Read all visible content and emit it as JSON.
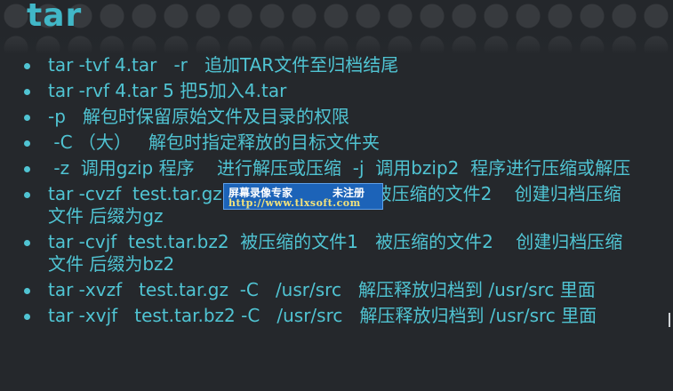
{
  "slide": {
    "title": "tar",
    "bullets": [
      {
        "text": "tar -tvf 4.tar   -r   追加TAR文件至归档结尾"
      },
      {
        "text": "tar -rvf 4.tar 5 把5加入4.tar"
      },
      {
        "text": "-p   解包时保留原始文件及目录的权限"
      },
      {
        "text": " -C （大）   解包时指定释放的目标文件夹"
      },
      {
        "text": " -z  调用gzip 程序    进行解压或压缩  -j  调用bzip2  程序进行压缩或解压"
      },
      {
        "text": "tar -cvzf  test.tar.gz   被压缩的文件1   被压缩的文件2    创建归档压缩文件 后缀为gz"
      },
      {
        "text": "tar -cvjf  test.tar.bz2  被压缩的文件1   被压缩的文件2    创建归档压缩文件 后缀为bz2"
      },
      {
        "text": "tar -xvzf   test.tar.gz  -C   /usr/src   解压释放归档到 /usr/src 里面"
      },
      {
        "text": "tar -xvjf   test.tar.bz2 -C   /usr/src   解压释放归档到 /usr/src 里面"
      }
    ]
  },
  "watermark": {
    "name": "屏幕录像专家",
    "status": "未注册",
    "url": "http://www.tlxsoft.com"
  },
  "colors": {
    "background": "#25282c",
    "title": "#41b7c7",
    "text": "#50c4d3",
    "watermark_bg": "#1c63b8"
  }
}
